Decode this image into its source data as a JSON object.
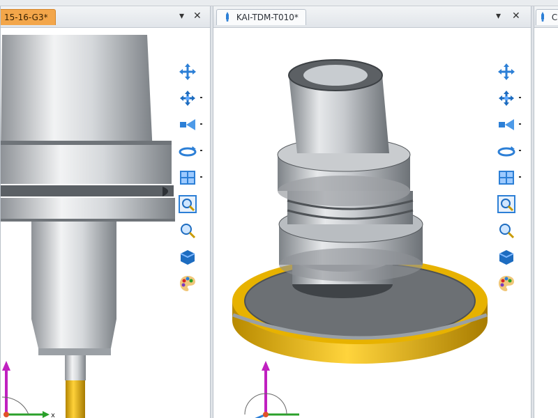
{
  "tabs": {
    "left": {
      "label": "15-16-G3*",
      "active": true
    },
    "middle": {
      "label": "KAI-TDM-T010*",
      "active": false
    },
    "right": {
      "label": "C",
      "active": false
    }
  },
  "tab_controls": {
    "pin": "▾",
    "close": "✕"
  },
  "toolbar": [
    {
      "name": "pan-icon"
    },
    {
      "name": "rotate-icon"
    },
    {
      "name": "dynamic-view-icon"
    },
    {
      "name": "spin-view-icon"
    },
    {
      "name": "standard-views-icon"
    },
    {
      "name": "zoom-window-icon"
    },
    {
      "name": "zoom-icon"
    },
    {
      "name": "shading-icon"
    },
    {
      "name": "color-palette-icon"
    }
  ],
  "triad": {
    "x_label": "x"
  },
  "colors": {
    "active_tab": "#f3a64a",
    "toolbar_blue": "#2c7fd6",
    "flange_gold": "#e1b000"
  }
}
